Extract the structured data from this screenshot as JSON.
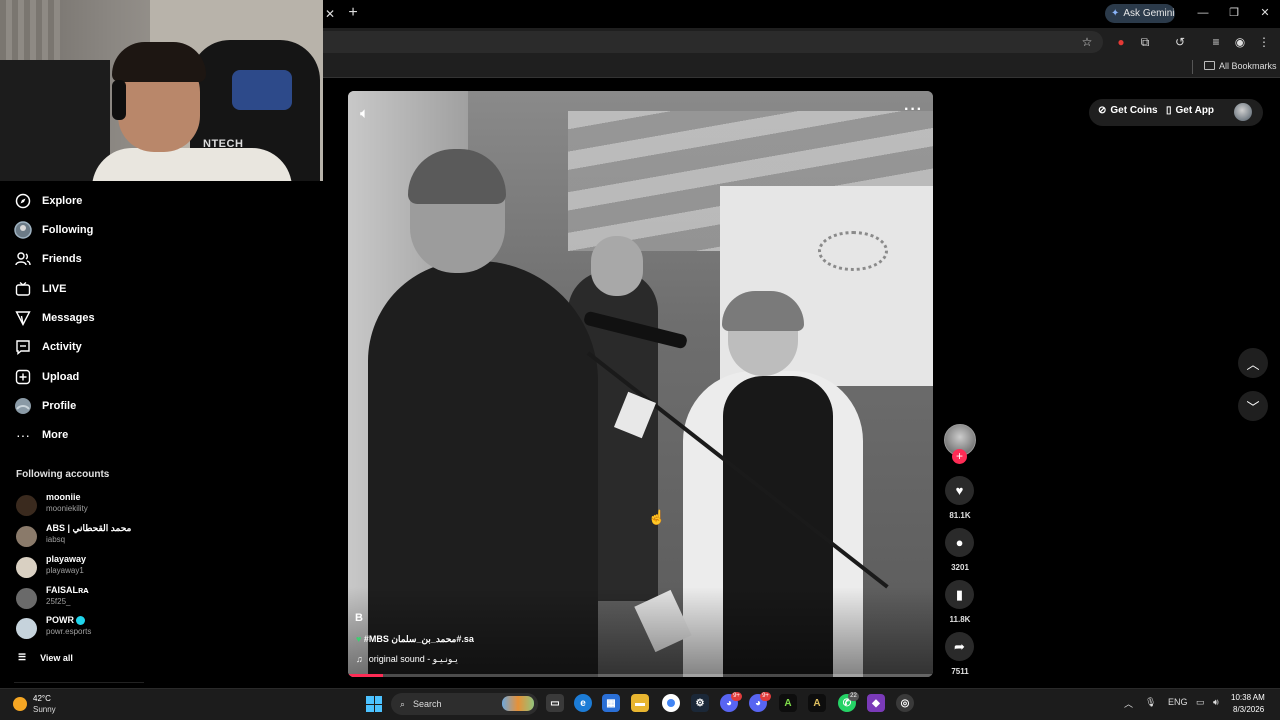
{
  "browser": {
    "gemini_label": "Ask Gemini",
    "bookmarks_label": "All Bookmarks"
  },
  "webcam": {
    "chair_brand": "NTECH"
  },
  "sidebar": {
    "items": [
      {
        "label": "Explore",
        "icon": "compass-icon"
      },
      {
        "label": "Following",
        "icon": "following-avatar-icon"
      },
      {
        "label": "Friends",
        "icon": "friends-icon"
      },
      {
        "label": "LIVE",
        "icon": "live-tv-icon"
      },
      {
        "label": "Messages",
        "icon": "send-icon"
      },
      {
        "label": "Activity",
        "icon": "activity-icon"
      },
      {
        "label": "Upload",
        "icon": "upload-plus-icon"
      },
      {
        "label": "Profile",
        "icon": "profile-avatar-icon"
      },
      {
        "label": "More",
        "icon": "more-dots-icon"
      }
    ],
    "following_title": "Following accounts",
    "accounts": [
      {
        "name": "mooniie",
        "handle": "mooniekility",
        "color": "#3a2a1e"
      },
      {
        "name": "ABS | محمد القحطاني",
        "handle": "iabsq",
        "color": "#8a7a6a"
      },
      {
        "name": "playaway",
        "handle": "playaway1",
        "color": "#d9d0c2"
      },
      {
        "name": "FAISALʀᴀ",
        "handle": "25f25_",
        "color": "#6a6a6a"
      },
      {
        "name": "POWR",
        "handle": "powr.esports",
        "color": "#c6d3dc",
        "verified": true
      }
    ],
    "view_all": "View all"
  },
  "video": {
    "author": "B",
    "caption_tags": "#MBS محمد_بن_سلمان#.sa",
    "music": "original sound - يـونـيـو",
    "progress": 0.06
  },
  "actions": {
    "likes": "81.1K",
    "comments": "3201",
    "saves": "11.8K",
    "shares": "7511"
  },
  "topbar": {
    "get_coins": "Get Coins",
    "get_app": "Get App"
  },
  "taskbar": {
    "temperature": "42°C",
    "weather": "Sunny",
    "search_placeholder": "Search",
    "language": "ENG",
    "time": "10:38 AM",
    "date": "8/3/2026",
    "badges": {
      "discord1": "9+",
      "discord2": "9+",
      "whatsapp": "22"
    }
  },
  "colors": {
    "accent": "#fe2c55",
    "verified": "#20d5ec",
    "windows": "#4cc2ff"
  }
}
